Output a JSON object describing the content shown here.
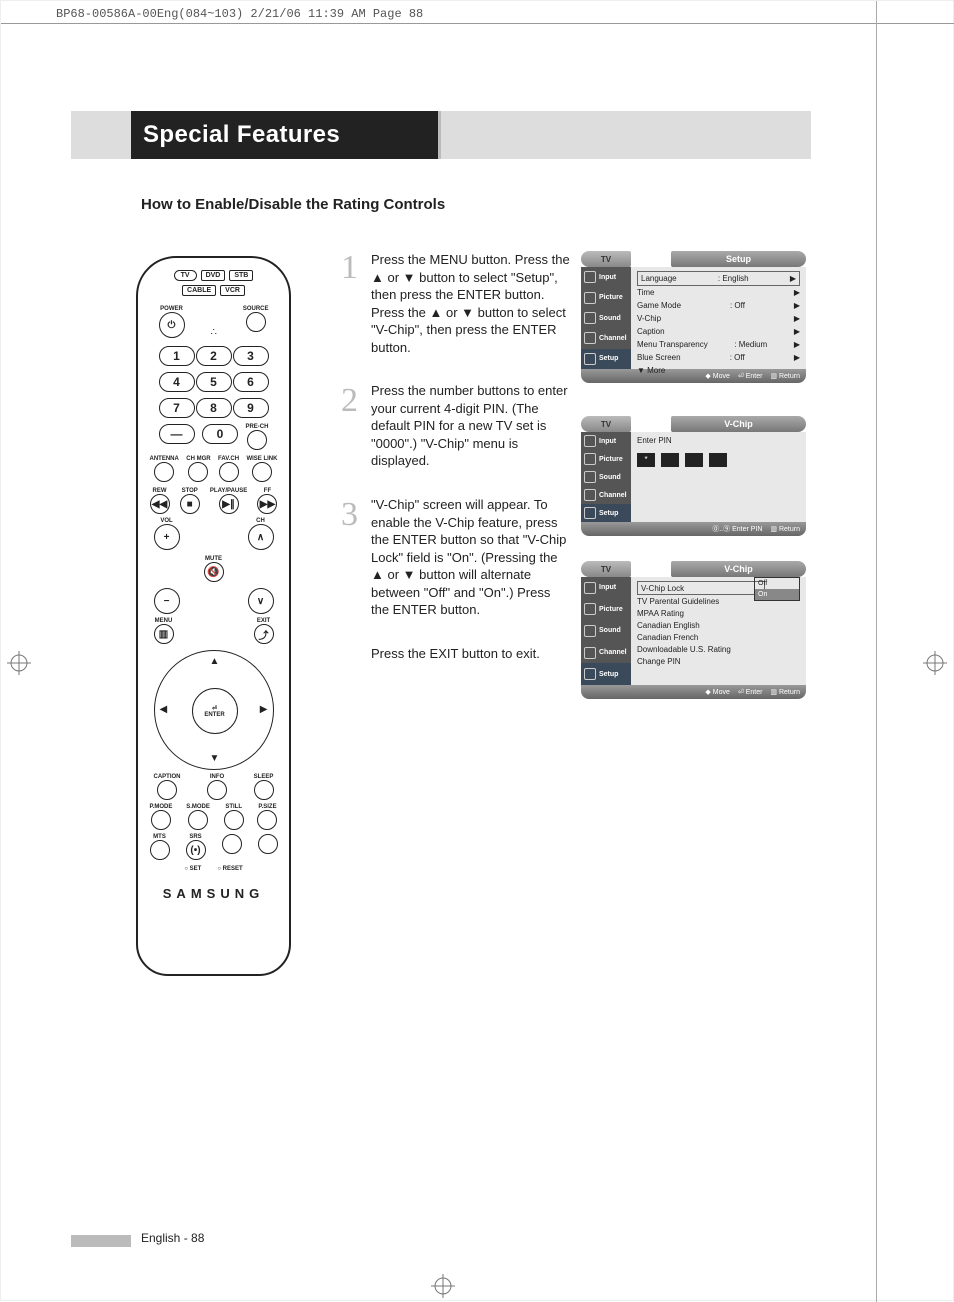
{
  "cropmark": "BP68-00586A-00Eng(084~103)  2/21/06  11:39 AM  Page 88",
  "section_title": "Special Features",
  "subtitle": "How to Enable/Disable the Rating Controls",
  "remote": {
    "devices_row1": [
      "TV",
      "DVD",
      "STB"
    ],
    "devices_row2": [
      "CABLE",
      "VCR"
    ],
    "power": "POWER",
    "source": "SOURCE",
    "numbers": [
      "1",
      "2",
      "3",
      "4",
      "5",
      "6",
      "7",
      "8",
      "9",
      "0"
    ],
    "dash": "—",
    "prech": "PRE-CH",
    "strip": [
      "ANTENNA",
      "CH MGR",
      "FAV.CH",
      "WISE LINK"
    ],
    "transport": [
      "REW",
      "STOP",
      "PLAY/PAUSE",
      "FF"
    ],
    "vol": "VOL",
    "ch": "CH",
    "mute": "MUTE",
    "menu": "MENU",
    "exit": "EXIT",
    "enter": "ENTER",
    "caption": "CAPTION",
    "info": "INFO",
    "sleep": "SLEEP",
    "modes": [
      "P.MODE",
      "S.MODE",
      "STILL",
      "P.SIZE"
    ],
    "mts": "MTS",
    "srs": "SRS",
    "setreset": [
      "SET",
      "RESET"
    ],
    "brand": "SAMSUNG"
  },
  "steps": {
    "s1": "Press the MENU button. Press the ▲ or ▼ button to select \"Setup\", then press the ENTER button. Press the ▲ or ▼ button to select \"V-Chip\", then press the ENTER button.",
    "s2": "Press the number buttons to enter your current 4-digit PIN. (The default PIN for a new TV set is \"0000\".) \"V-Chip\" menu is displayed.",
    "s3": "\"V-Chip\" screen will appear. To enable the V-Chip feature, press the ENTER button so that \"V-Chip Lock\" field is \"On\". (Pressing the ▲ or ▼ button will alternate between \"Off\" and \"On\".) Press the ENTER button.",
    "exit": "Press the EXIT button to exit."
  },
  "osd": {
    "tv": "TV",
    "side": [
      "Input",
      "Picture",
      "Sound",
      "Channel",
      "Setup"
    ],
    "panel1": {
      "title": "Setup",
      "rows": [
        {
          "k": "Language",
          "v": ": English"
        },
        {
          "k": "Time",
          "v": ""
        },
        {
          "k": "Game Mode",
          "v": ": Off"
        },
        {
          "k": "V-Chip",
          "v": ""
        },
        {
          "k": "Caption",
          "v": ""
        },
        {
          "k": "Menu Transparency",
          "v": ": Medium"
        },
        {
          "k": "Blue Screen",
          "v": ": Off"
        },
        {
          "k": "▼ More",
          "v": ""
        }
      ],
      "footer": [
        "Move",
        "Enter",
        "Return"
      ]
    },
    "panel2": {
      "title": "V-Chip",
      "prompt": "Enter PIN",
      "footer": [
        "Enter PIN",
        "Return"
      ]
    },
    "panel3": {
      "title": "V-Chip",
      "lines": [
        "V-Chip Lock",
        "TV Parental Guidelines",
        "MPAA Rating",
        "Canadian English",
        "Canadian French",
        "Downloadable U.S. Rating",
        "Change PIN"
      ],
      "options": [
        "Off",
        "On"
      ],
      "footer": [
        "Move",
        "Enter",
        "Return"
      ]
    }
  },
  "footer": "English - 88"
}
